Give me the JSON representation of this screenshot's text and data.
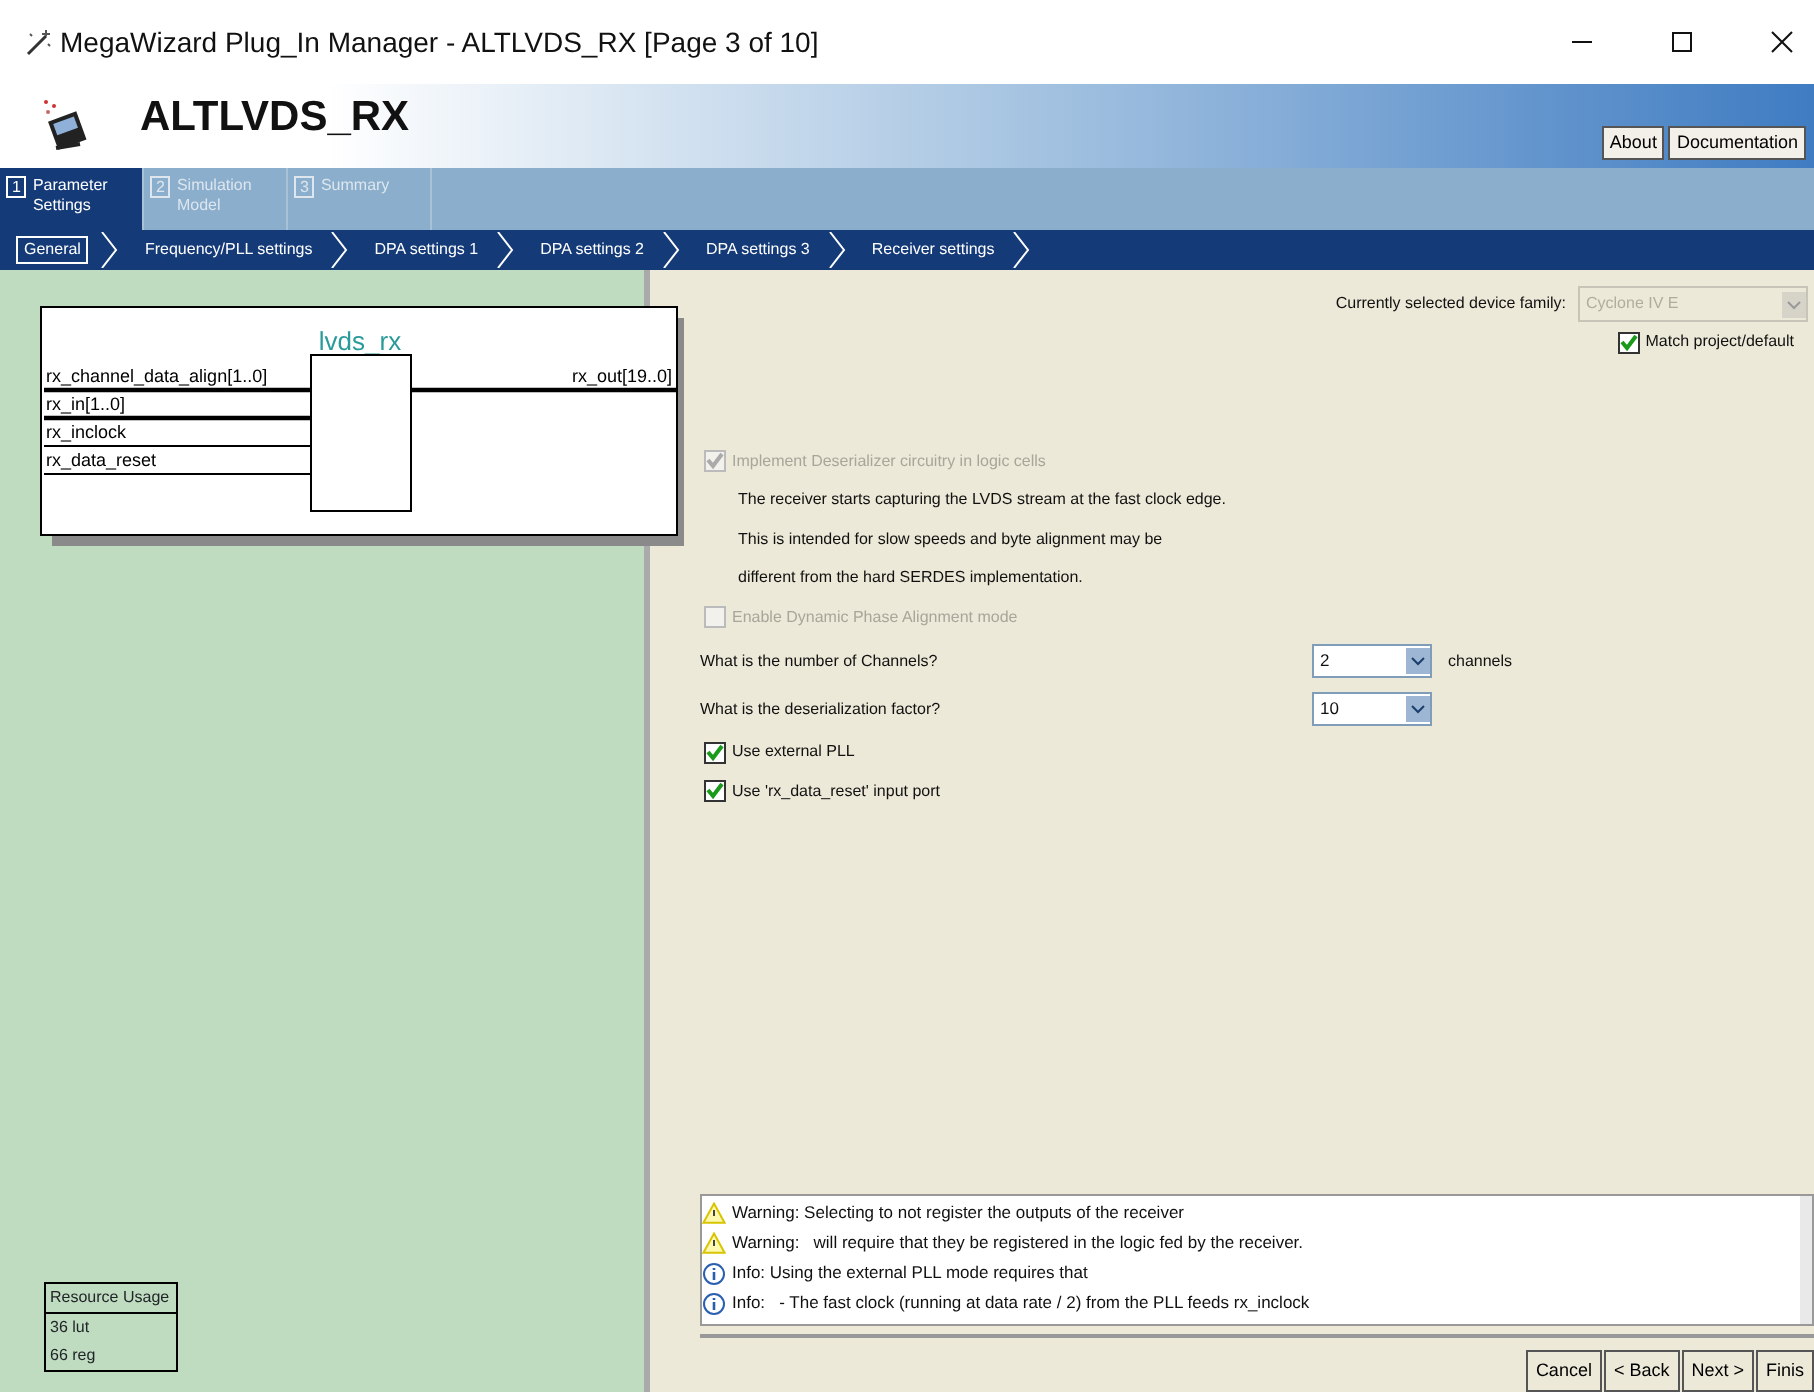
{
  "window": {
    "title": "MegaWizard Plug_In Manager - ALTLVDS_RX [Page 3 of 10]"
  },
  "header": {
    "title": "ALTLVDS_RX",
    "buttons": [
      {
        "label": "About"
      },
      {
        "label": "Documentation"
      }
    ]
  },
  "tabs": [
    {
      "number": "1",
      "label": "Parameter Settings",
      "selected": true
    },
    {
      "number": "2",
      "label": "Simulation Model",
      "selected": false
    },
    {
      "number": "3",
      "label": "Summary",
      "selected": false
    }
  ],
  "steps": [
    {
      "label": "General",
      "selected": true
    },
    {
      "label": "Frequency/PLL settings",
      "selected": false
    },
    {
      "label": "DPA settings 1",
      "selected": false
    },
    {
      "label": "DPA settings 2",
      "selected": false
    },
    {
      "label": "DPA settings 3",
      "selected": false
    },
    {
      "label": "Receiver settings",
      "selected": false
    }
  ],
  "diagram": {
    "title": "lvds_rx",
    "inputs": [
      {
        "name": "rx_channel_data_align[1..0]",
        "bus": true
      },
      {
        "name": "rx_in[1..0]",
        "bus": true
      },
      {
        "name": "rx_inclock",
        "bus": false
      },
      {
        "name": "rx_data_reset",
        "bus": false
      }
    ],
    "outputs": [
      {
        "name": "rx_out[19..0]",
        "bus": true
      }
    ]
  },
  "resource_usage": {
    "title": "Resource Usage",
    "lines": [
      "36 lut",
      "66 reg"
    ]
  },
  "device_family": {
    "label": "Currently selected device family:",
    "value": "Cyclone IV E",
    "disabled": true
  },
  "match_project": {
    "label": "Match project/default",
    "checked": true
  },
  "options": [
    {
      "kind": "checkbox",
      "label": "Implement Deserializer circuitry in logic cells",
      "checked": true,
      "disabled": true
    },
    {
      "kind": "note",
      "text": "The receiver starts capturing the LVDS stream at the fast clock edge."
    },
    {
      "kind": "note",
      "text": "This is intended for slow speeds and byte alignment may be"
    },
    {
      "kind": "note",
      "text": "different from the hard SERDES implementation."
    },
    {
      "kind": "checkbox",
      "label": "Enable Dynamic Phase Alignment mode",
      "checked": false,
      "disabled": true
    },
    {
      "kind": "select",
      "label": "What is the number of Channels?",
      "value": "2",
      "unit": "channels"
    },
    {
      "kind": "select",
      "label": "What is the deserialization factor?",
      "value": "10"
    },
    {
      "kind": "checkbox",
      "label": "Use external PLL",
      "checked": true,
      "disabled": false
    },
    {
      "kind": "checkbox",
      "label": "Use 'rx_data_reset' input port",
      "checked": true,
      "disabled": false
    }
  ],
  "messages": [
    {
      "kind": "warning",
      "text": "Warning: Selecting to not register the outputs of the receiver"
    },
    {
      "kind": "warning",
      "text": "Warning:   will require that they be registered in the logic fed by the receiver."
    },
    {
      "kind": "info",
      "text": "Info: Using the external PLL mode requires that"
    },
    {
      "kind": "info",
      "text": "Info:   - The fast clock (running at data rate / 2) from the PLL feeds rx_inclock"
    }
  ],
  "buttons": [
    {
      "label": "Cancel"
    },
    {
      "label": "< Back"
    },
    {
      "label": "Next >"
    },
    {
      "label": "Finis"
    }
  ]
}
